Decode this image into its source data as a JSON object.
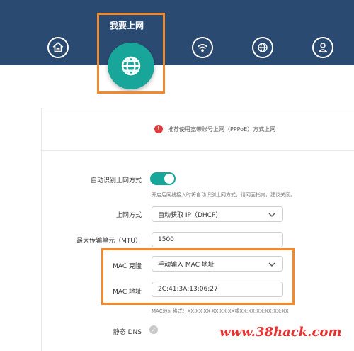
{
  "nav": {
    "active_title": "我要上网",
    "items": [
      {
        "icon": "home-icon"
      },
      {
        "icon": "globe-icon"
      },
      {
        "icon": "wifi-icon"
      },
      {
        "icon": "settings-globe-icon"
      },
      {
        "icon": "user-icon"
      }
    ]
  },
  "notice": {
    "icon": "warning-icon",
    "text": "推荐使用宽带账号上网（PPPoE）方式上网"
  },
  "form": {
    "auto_detect": {
      "label": "自动识别上网方式",
      "enabled": true,
      "hint": "开启后网线接入时将自动识别上网方式，请网面指南，建议关闭。"
    },
    "connection_type": {
      "label": "上网方式",
      "value": "自动获取 IP（DHCP）"
    },
    "mtu": {
      "label": "最大传输单元（MTU）",
      "value": "1500"
    },
    "mac_clone": {
      "label": "MAC 克隆",
      "value": "手动输入 MAC 地址"
    },
    "mac_address": {
      "label": "MAC 地址",
      "value": "2C:41:3A:13:06:27",
      "hint": "MAC地址格式：XX-XX-XX-XX-XX-XX或XX:XX:XX:XX:XX:XX"
    },
    "static_dns": {
      "label": "静态 DNS"
    }
  },
  "colors": {
    "header": "#2b4a72",
    "accent": "#18a69a",
    "highlight": "#f08a2c",
    "warning": "#e23a3a"
  },
  "watermark": "www.38hack.com"
}
